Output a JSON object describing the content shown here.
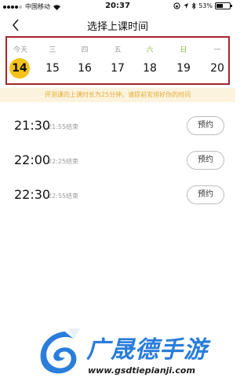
{
  "status_bar": {
    "carrier": "中国移动",
    "time": "20:37",
    "battery": "53%",
    "battery_level": 0.53
  },
  "nav": {
    "title": "选择上课时间"
  },
  "calendar": {
    "days": [
      {
        "weekday": "今天",
        "date": "14",
        "selected": true,
        "weekend": false
      },
      {
        "weekday": "三",
        "date": "15",
        "selected": false,
        "weekend": false
      },
      {
        "weekday": "四",
        "date": "16",
        "selected": false,
        "weekend": false
      },
      {
        "weekday": "五",
        "date": "17",
        "selected": false,
        "weekend": false
      },
      {
        "weekday": "六",
        "date": "18",
        "selected": false,
        "weekend": true
      },
      {
        "weekday": "日",
        "date": "19",
        "selected": false,
        "weekend": true
      },
      {
        "weekday": "一",
        "date": "20",
        "selected": false,
        "weekend": false
      }
    ]
  },
  "notice": "评测课的上课时长为25分钟，请提前安排好你的时间",
  "slots": [
    {
      "time": "21:30",
      "end": "21:55结束",
      "button": "预约"
    },
    {
      "time": "22:00",
      "end": "22:25结束",
      "button": "预约"
    },
    {
      "time": "22:30",
      "end": "22:55结束",
      "button": "预约"
    }
  ],
  "watermark": {
    "brand": "广晟德手游",
    "url": "www.gsdtiepianji.com"
  },
  "colors": {
    "accent_yellow": "#f5c21b",
    "highlight_box": "#a3272d",
    "notice_bg": "#fbf3dd",
    "notice_text": "#e3ad37",
    "weekend_green": "#8bbb3c",
    "watermark_blue": "#2a7ddb"
  }
}
